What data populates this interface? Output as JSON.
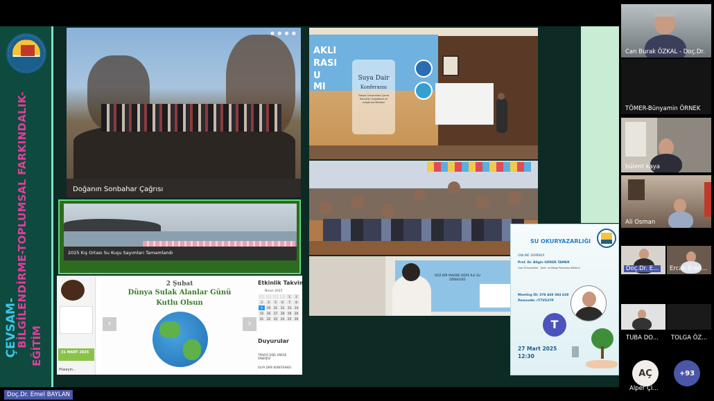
{
  "slide": {
    "vertical_title_line1": "ÇEVSAM-",
    "vertical_title_line2": "BİLGİLENDİRME-TOPLUMSAL FARKINDALIK-",
    "vertical_title_line3": "EĞİTİM",
    "logo_text": "TRAKYA ÜNİVERSİTESİ",
    "photo1_caption": "Doğanın Sonbahar Çağrısı",
    "photo2_caption": "2025 Kış Ortası Su Kuşu Sayımları Tamamlandı",
    "poster1": {
      "line1": "AKLI",
      "line2": "RASI",
      "line3": "U",
      "line4": "MI",
      "title": "Suya Dair",
      "subtitle": "Konferansı",
      "body": "Trakya Üniversitesi Çevre Sorunları Uygulama ve Araştırma Merkezi"
    },
    "wetland": {
      "date": "2 Şubat",
      "line1": "Dünya Sulak Alanlar Günü",
      "line2": "Kutlu Olsun",
      "calendar_title": "Etkinlik Takvimi",
      "calendar_month": "Nisan 2025",
      "announcements_title": "Duyurular",
      "ann_item1": "TRAKYA DİŞİL ENERJİ SİNERJİSİ",
      "ann_item2": "SUYA DAİR KONFERANSI",
      "left_col_label1": "31 MART 2025",
      "left_col_label2": "Hüseyin...",
      "arrow_left": "‹",
      "arrow_right": "›"
    },
    "classroom_board": "DÜZ BİR MADDE KÜRE İLE SU DÖNGÜSÜ",
    "poster2": {
      "title": "SU OKURYAZARLIĞI",
      "type": "ONLINE SEMİNER",
      "speaker": "Prof. Dr. Bilgin GÖRER TAMER",
      "affiliation": "Gazi Üniversitesi · Şehir ve Bölge Planlama Bölümü",
      "meeting_id": "Meeting ID: 378 469 384 628",
      "passcode": "Passcode: rT7VS37P",
      "date": "27 Mart 2025",
      "time": "12:30"
    }
  },
  "participants": [
    {
      "name": "Can Burak ÖZKAL - Doç.Dr."
    },
    {
      "name": "TÖMER-Bünyamin ÖRNEK"
    },
    {
      "name": "bülent kaya"
    },
    {
      "name": "Ali Osman"
    },
    {
      "name": "Doç.Dr. E..."
    },
    {
      "name": "Ercan Eren..."
    },
    {
      "name": "TUBA DO..."
    },
    {
      "name": "TOLGA ÖZ..."
    },
    {
      "name": "Alper Çİ...",
      "initials": "AÇ"
    }
  ],
  "more_count": "+93",
  "presenter": "Doç.Dr. Emel BAYLAN",
  "colors": {
    "accent_pink": "#e23e9b",
    "accent_green": "#5fd97d",
    "accent_cyan": "#39c6e8",
    "badge": "#4a56a6"
  }
}
